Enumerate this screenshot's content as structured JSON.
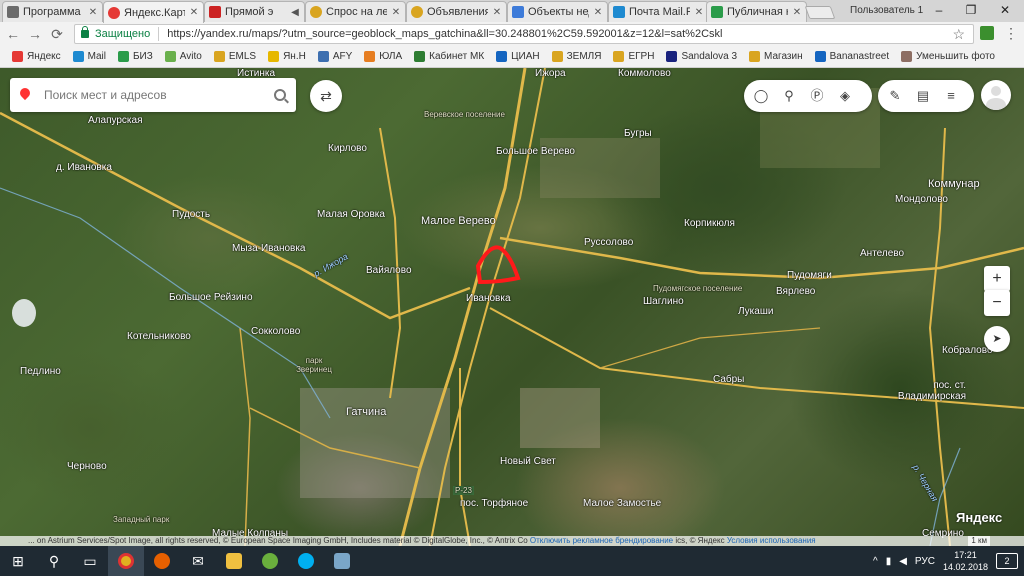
{
  "browser": {
    "tabs": [
      {
        "title": "Программа",
        "favicon_color": "#6b6b6b"
      },
      {
        "title": "Яндекс.Карты",
        "favicon_color": "#e53935",
        "active": true
      },
      {
        "title": "Прямой э",
        "favicon_color": "#cc2222"
      },
      {
        "title": "Спрос на ле",
        "favicon_color": "#d9a520"
      },
      {
        "title": "Объявления",
        "favicon_color": "#d9a520"
      },
      {
        "title": "Объекты нед",
        "favicon_color": "#3d7bd9"
      },
      {
        "title": "Почта Mail.R",
        "favicon_color": "#1e8ad0"
      },
      {
        "title": "Публичная к",
        "favicon_color": "#2b9c4a"
      }
    ],
    "user_label": "Пользователь 1",
    "window_controls": {
      "minimize": "–",
      "maximize": "❐",
      "close": "✕"
    },
    "nav": {
      "back": "←",
      "forward": "→",
      "reload": "⟳"
    },
    "secure_label": "Защищено",
    "url": "https://yandex.ru/maps/?utm_source=geoblock_maps_gatchina&ll=30.248801%2C59.592001&z=12&l=sat%2Cskl",
    "bookmarks": [
      {
        "label": "Яндекс",
        "color": "#e53935"
      },
      {
        "label": "Mail",
        "color": "#1e8ad0"
      },
      {
        "label": "БИЗ",
        "color": "#2b9c4a"
      },
      {
        "label": "Avito",
        "color": "#6ab04c"
      },
      {
        "label": "EMLS",
        "color": "#d9a520"
      },
      {
        "label": "Ян.Н",
        "color": "#e6b800"
      },
      {
        "label": "AFY",
        "color": "#3d6fb0"
      },
      {
        "label": "ЮЛА",
        "color": "#e67e22"
      },
      {
        "label": "Кабинет МК",
        "color": "#2e7d32"
      },
      {
        "label": "ЦИАН",
        "color": "#1565c0"
      },
      {
        "label": "ЗЕМЛЯ",
        "color": "#d9a520"
      },
      {
        "label": "ЕГРН",
        "color": "#d9a520"
      },
      {
        "label": "Sandalova 3",
        "color": "#1a237e"
      },
      {
        "label": "Магазин",
        "color": "#d9a520"
      },
      {
        "label": "Bananastreet",
        "color": "#1565c0"
      },
      {
        "label": "Уменьшить фото",
        "color": "#8d6e63"
      }
    ]
  },
  "map": {
    "search_placeholder": "Поиск мест и адресов",
    "controls": {
      "layers": [
        "traffic-icon",
        "bike-icon",
        "parking-icon",
        "layers-icon"
      ],
      "tools": [
        "ruler-icon",
        "print-icon",
        "menu-icon"
      ]
    },
    "zoom_in": "+",
    "zoom_out": "−",
    "brand": "Яндекс",
    "scale": "1 км",
    "attribution": "... on Astrium Services/Spot Image, all rights reserved, © European Space Imaging GmbH, Includes material © DigitalGlobe, Inc., © Antrix Co",
    "attribution_link1": "Отключить рекламное брендирование",
    "attribution_tail": "ics, © Яндекс",
    "attribution_link2": "Условия использования",
    "labels": [
      {
        "text": "Истинка"
      },
      {
        "text": "Ижора"
      },
      {
        "text": "Коммолово"
      },
      {
        "text": "Алапурская"
      },
      {
        "text": "Веревское поселение"
      },
      {
        "text": "Бугры"
      },
      {
        "text": "д. Ивановка"
      },
      {
        "text": "Кирлово"
      },
      {
        "text": "Большое Верево"
      },
      {
        "text": "Коммунар"
      },
      {
        "text": "Пудость"
      },
      {
        "text": "Малая Оровка"
      },
      {
        "text": "Малое Верево"
      },
      {
        "text": "Корпикюля"
      },
      {
        "text": "Мондолово"
      },
      {
        "text": "Мыза-Ивановка"
      },
      {
        "text": "р. Ижора"
      },
      {
        "text": "Руссолово"
      },
      {
        "text": "Антелево"
      },
      {
        "text": "Вайялово"
      },
      {
        "text": "Пудомяги"
      },
      {
        "text": "Большое Рейзино"
      },
      {
        "text": "Ивановка"
      },
      {
        "text": "Пудомягское поселение"
      },
      {
        "text": "Вярлево"
      },
      {
        "text": "Шаглино"
      },
      {
        "text": "Сокколово"
      },
      {
        "text": "Лукаши"
      },
      {
        "text": "Котельниково"
      },
      {
        "text": "Кобралово"
      },
      {
        "text": "парк Зверинец"
      },
      {
        "text": "Педлино"
      },
      {
        "text": "Сабры"
      },
      {
        "text": "пос. ст. Владимирская"
      },
      {
        "text": "Гатчина"
      },
      {
        "text": "Чернoво"
      },
      {
        "text": "Новый Свет"
      },
      {
        "text": "р. Черная"
      },
      {
        "text": "пос. Торфяное"
      },
      {
        "text": "Малое Замостье"
      },
      {
        "text": "Западный парк"
      },
      {
        "text": "Малые Колпаны"
      },
      {
        "text": "Семрино"
      },
      {
        "text": "Р-23"
      }
    ]
  },
  "taskbar": {
    "lang": "РУС",
    "time": "17:21",
    "date": "14.02.2018",
    "notifications": "2",
    "apps": [
      "windows-start-icon",
      "search-icon",
      "task-view-icon",
      "chrome-icon",
      "firefox-icon",
      "mail-icon",
      "file-explorer-icon",
      "utorrent-icon",
      "skype-icon",
      "tool-icon"
    ]
  }
}
